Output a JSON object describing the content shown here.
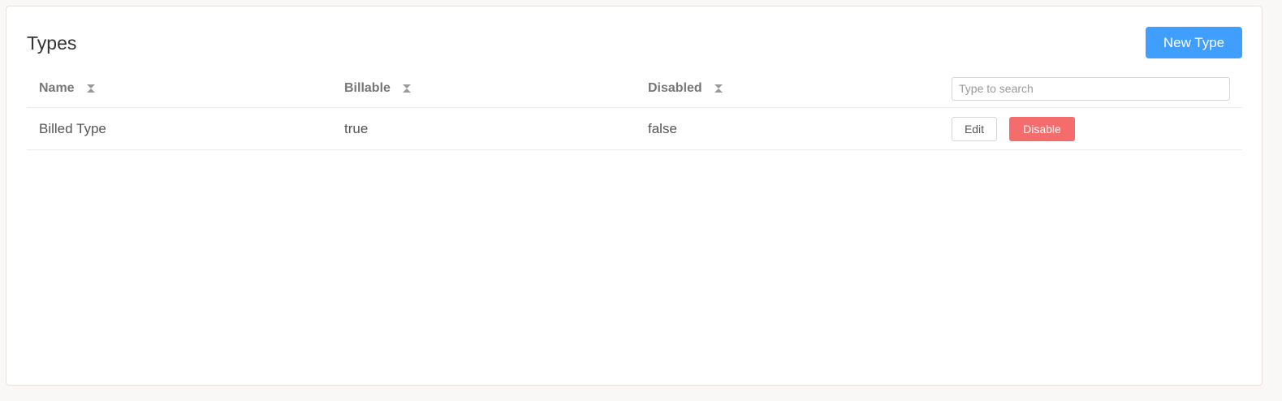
{
  "page": {
    "title": "Types",
    "new_button_label": "New Type"
  },
  "table": {
    "columns": [
      "Name",
      "Billable",
      "Disabled"
    ],
    "sort_icon": "sort-hourglass-icon",
    "search_placeholder": "Type to search",
    "rows": [
      {
        "name": "Billed Type",
        "billable": "true",
        "disabled": "false",
        "edit_label": "Edit",
        "disable_label": "Disable"
      }
    ]
  },
  "colors": {
    "primary": "#409eff",
    "danger": "#f56c6c",
    "border": "#ececec"
  }
}
